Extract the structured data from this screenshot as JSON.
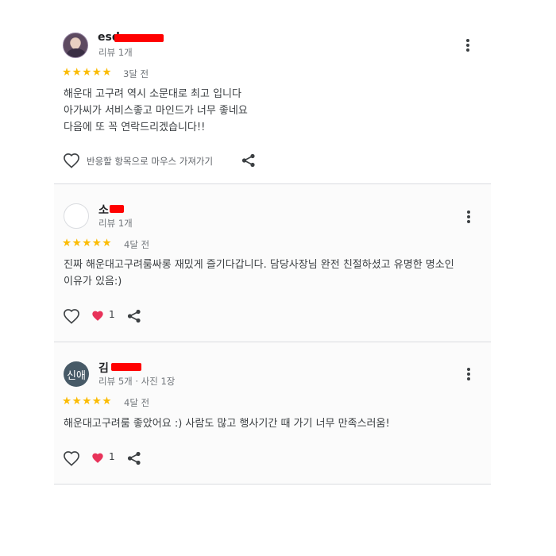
{
  "reviews": [
    {
      "name_prefix": "esd",
      "meta": "리뷰 1개",
      "stars": "★★★★★",
      "time": "3달 전",
      "text": [
        "해운대 고구려 역시 소문대로 최고 입니다",
        "아가씨가 서비스좋고 마인드가 너무 좋네요",
        "다음에 또 꼭 연락드리겠습니다!!"
      ],
      "hover_hint": "반응할 항목으로 마우스 가져가기"
    },
    {
      "name_prefix": "소",
      "meta": "리뷰 1개",
      "stars": "★★★★★",
      "time": "4달 전",
      "text": [
        "진짜 해운대고구려룸싸롱 재밌게 즐기다갑니다. 담당사장님 완전 친절하셨고 유명한 명소인",
        "이유가 있음:)"
      ],
      "like_count": "1"
    },
    {
      "name_prefix": "김",
      "avatar_initials": "신애",
      "meta": "리뷰 5개 · 사진 1장",
      "stars": "★★★★★",
      "time": "4달 전",
      "text": [
        "해운대고구려룸 좋았어요 :) 사람도 많고 행사기간 때 가기 너무 만족스러움!"
      ],
      "like_count": "1"
    }
  ],
  "colors": {
    "star": "#fbbc04",
    "redaction": "#ff0000",
    "heart_filled": "#e8335a"
  }
}
